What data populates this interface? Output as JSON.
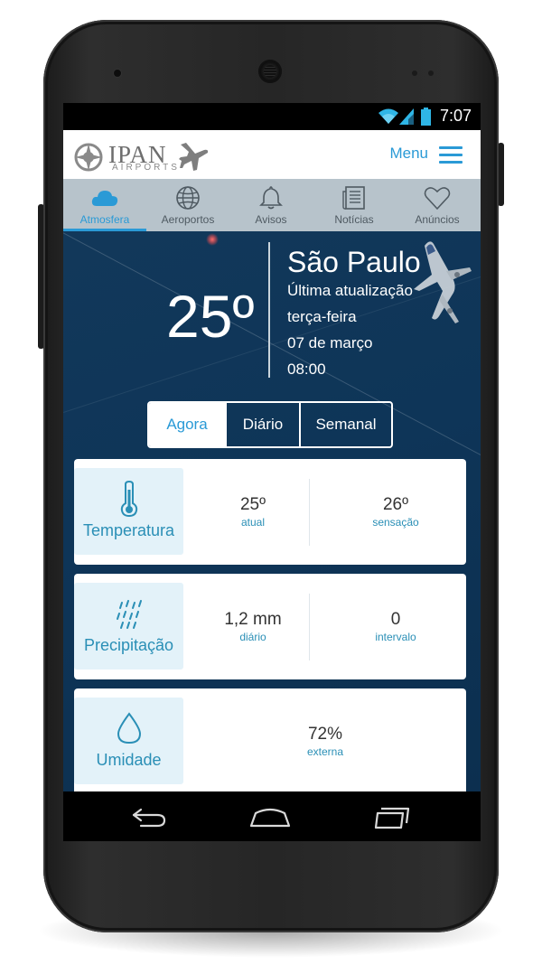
{
  "status_bar": {
    "time": "7:07"
  },
  "header": {
    "logo_name": "IPAN",
    "logo_sub": "AIRPORTS",
    "menu_label": "Menu"
  },
  "tabs": [
    {
      "label": "Atmosfera",
      "icon": "cloud-icon",
      "active": true
    },
    {
      "label": "Aeroportos",
      "icon": "globe-icon",
      "active": false
    },
    {
      "label": "Avisos",
      "icon": "bell-icon",
      "active": false
    },
    {
      "label": "Notícias",
      "icon": "newspaper-icon",
      "active": false
    },
    {
      "label": "Anúncios",
      "icon": "heart-icon",
      "active": false
    }
  ],
  "weather": {
    "temperature": "25º",
    "city": "São Paulo",
    "updated_label": "Última atualização",
    "weekday": "terça-feira",
    "date": "07 de março",
    "time": "08:00"
  },
  "segments": [
    {
      "label": "Agora",
      "active": true
    },
    {
      "label": "Diário",
      "active": false
    },
    {
      "label": "Semanal",
      "active": false
    }
  ],
  "cards": {
    "temperature": {
      "title": "Temperatura",
      "icon": "thermometer-icon",
      "metrics": [
        {
          "value": "25º",
          "sub": "atual"
        },
        {
          "value": "26º",
          "sub": "sensação"
        }
      ]
    },
    "precipitation": {
      "title": "Precipitação",
      "icon": "rain-icon",
      "metrics": [
        {
          "value": "1,2 mm",
          "sub": "diário"
        },
        {
          "value": "0",
          "sub": "intervalo"
        }
      ]
    },
    "humidity": {
      "title": "Umidade",
      "icon": "droplet-icon",
      "metrics": [
        {
          "value": "72%",
          "sub": "externa"
        }
      ]
    }
  },
  "colors": {
    "accent": "#2a9ad6",
    "tab_bar": "#b7c3cb",
    "background": "#0e3558",
    "card_badge": "#e3f2f9"
  }
}
